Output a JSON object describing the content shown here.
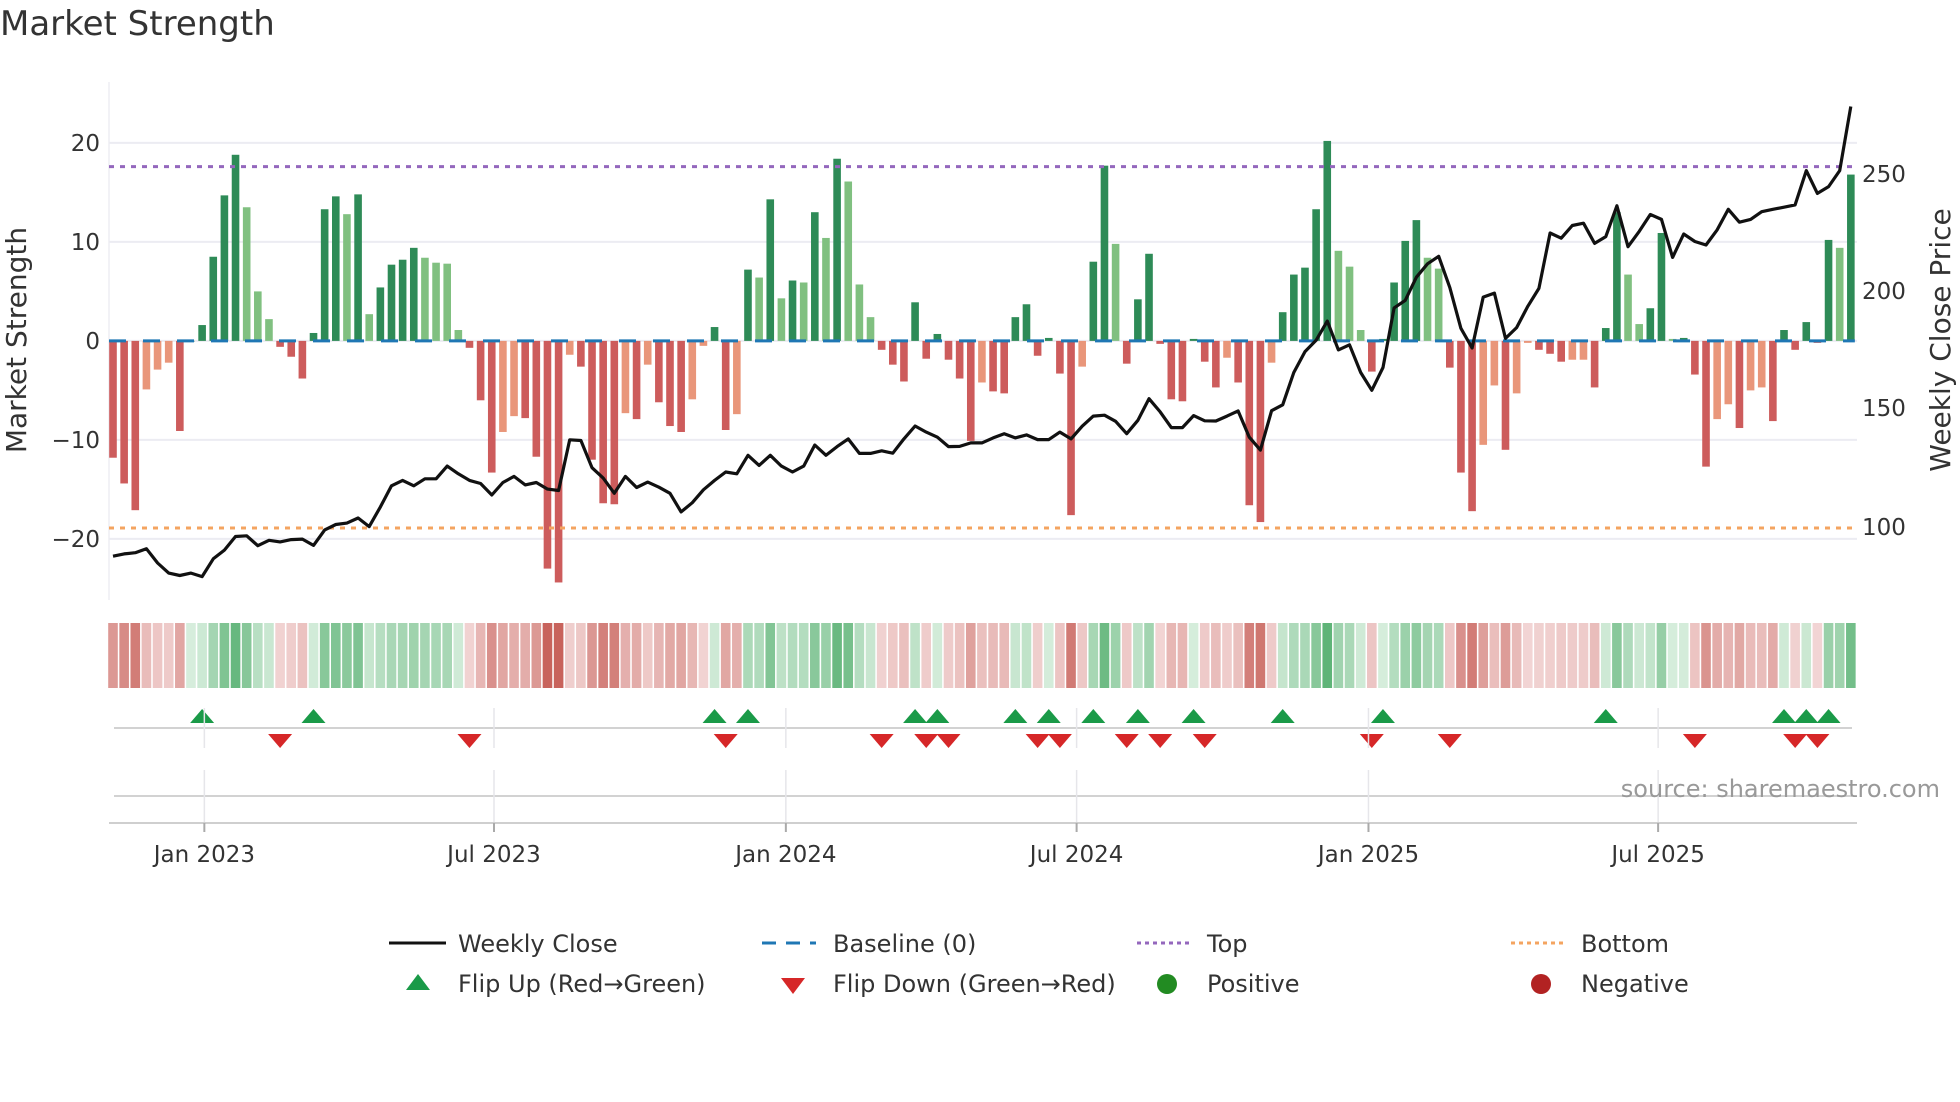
{
  "title": "Market Strength",
  "source": "source: sharemaestro.com",
  "colors": {
    "bar_strong_positive": "#2e8b57",
    "bar_weak_positive": "#80c080",
    "bar_strong_negative": "#cd5c5c",
    "bar_weak_negative": "#e9967a",
    "close_line": "#111111",
    "baseline": "#1f77b4",
    "top": "#9467bd",
    "bottom": "#f4a460",
    "flip_up": "#1a9a48",
    "flip_down": "#d62728",
    "positive": "#228b22",
    "negative": "#b22222"
  },
  "chart_data": {
    "type": "bar+line",
    "title": "Market Strength",
    "ylabel": "Market Strength",
    "y2label": "Weekly Close Price",
    "ylim": [
      -25.5,
      26.5
    ],
    "y2lim": [
      70,
      285
    ],
    "y_ticks": [
      "20",
      "10",
      "0",
      "−10",
      "−20"
    ],
    "y_tick_values": [
      20,
      10,
      0,
      -10,
      -20
    ],
    "y2_ticks": [
      "250",
      "200",
      "150",
      "100"
    ],
    "y2_tick_values": [
      250,
      200,
      150,
      100
    ],
    "x_ticks": [
      {
        "label": "Jan 2023",
        "week_index": 8.2
      },
      {
        "label": "Jul 2023",
        "week_index": 34.2
      },
      {
        "label": "Jan 2024",
        "week_index": 60.4
      },
      {
        "label": "Jul 2024",
        "week_index": 86.5
      },
      {
        "label": "Jan 2025",
        "week_index": 112.7
      },
      {
        "label": "Jul 2025",
        "week_index": 138.7
      }
    ],
    "top_threshold": 17.6,
    "bottom_threshold": -18.9,
    "baseline": 0,
    "strength": [
      -11.8,
      -14.4,
      -17.1,
      -4.9,
      -2.9,
      -2.2,
      -9.1,
      0,
      1.6,
      8.5,
      14.7,
      18.8,
      13.5,
      5.0,
      2.2,
      -0.6,
      -1.6,
      -3.8,
      0.8,
      13.3,
      14.6,
      12.8,
      14.8,
      2.7,
      5.4,
      7.7,
      8.2,
      9.4,
      8.4,
      7.9,
      7.8,
      1.1,
      -0.7,
      -6.0,
      -13.3,
      -9.2,
      -7.6,
      -7.8,
      -11.7,
      -23.0,
      -24.4,
      -1.4,
      -2.6,
      -12.0,
      -16.4,
      -16.5,
      -7.3,
      -7.9,
      -2.4,
      -6.2,
      -8.6,
      -9.2,
      -5.9,
      -0.5,
      1.4,
      -9.0,
      -7.4,
      7.2,
      6.4,
      14.3,
      4.3,
      6.1,
      5.9,
      13.0,
      10.4,
      18.4,
      16.1,
      5.7,
      2.4,
      -0.9,
      -2.4,
      -4.1,
      3.9,
      -1.8,
      0.7,
      -1.9,
      -3.8,
      -10.1,
      -4.2,
      -5.1,
      -5.3,
      2.4,
      3.7,
      -1.5,
      0.3,
      -3.3,
      -17.6,
      -2.6,
      8.0,
      17.7,
      9.8,
      -2.3,
      4.2,
      8.8,
      -0.3,
      -5.9,
      -6.1,
      0.2,
      -2.1,
      -4.7,
      -1.7,
      -4.2,
      -16.6,
      -18.3,
      -2.2,
      2.9,
      6.7,
      7.4,
      13.3,
      20.2,
      9.1,
      7.5,
      1.1,
      -3.1,
      0.2,
      5.9,
      10.1,
      12.2,
      8.4,
      7.3,
      -2.7,
      -13.3,
      -17.2,
      -10.5,
      -4.5,
      -11.0,
      -5.3,
      -0.2,
      -0.9,
      -1.3,
      -2.1,
      -1.9,
      -1.9,
      -4.7,
      1.3,
      13.0,
      6.7,
      1.7,
      3.3,
      10.9,
      0.2,
      0.3,
      -3.4,
      -12.7,
      -7.9,
      -6.4,
      -8.8,
      -5.0,
      -4.7,
      -8.1,
      1.1,
      -0.9,
      1.9,
      -0.2,
      10.2,
      9.4,
      16.8
    ],
    "close": [
      87.4,
      88.4,
      88.9,
      90.6,
      84.5,
      80.2,
      79.2,
      80.2,
      78.7,
      86.3,
      90,
      95.8,
      96.1,
      91.9,
      94.2,
      93.5,
      94.5,
      94.7,
      92,
      98.6,
      100.9,
      101.5,
      103.7,
      100,
      108.4,
      117.4,
      119.7,
      117.4,
      120.4,
      120.4,
      125.8,
      122.5,
      119.7,
      118.4,
      113.5,
      118.8,
      121.4,
      117.8,
      118.8,
      116,
      115.4,
      137,
      136.7,
      125.1,
      120.7,
      114.2,
      121.4,
      116.7,
      119,
      116.8,
      114.2,
      106.3,
      110.2,
      115.7,
      119.7,
      123.3,
      122.5,
      130.4,
      126.1,
      130.4,
      125.8,
      123.3,
      125.8,
      134.8,
      130.4,
      134.1,
      137.4,
      131.2,
      131.2,
      132.3,
      131.3,
      137.4,
      142.9,
      140.3,
      138.1,
      134.1,
      134.2,
      135.7,
      135.7,
      137.8,
      139.6,
      137.8,
      139.1,
      137.1,
      137.1,
      140.3,
      137.4,
      142.8,
      147.1,
      147.5,
      144.9,
      139.6,
      145.3,
      154.5,
      148.9,
      142.2,
      142.2,
      147.3,
      145.1,
      145,
      147.1,
      149.3,
      138.1,
      132.6,
      149.4,
      151.9,
      165.7,
      174.6,
      179.4,
      187.6,
      175.3,
      177.5,
      165.7,
      158.1,
      167.8,
      193.2,
      196.4,
      206.3,
      212,
      215.2,
      201.9,
      184.5,
      176.1,
      197.8,
      199.5,
      180.2,
      184.8,
      193.9,
      201.5,
      225.1,
      222.9,
      228.3,
      229.3,
      220.7,
      223.6,
      236.7,
      219.3,
      225.8,
      233,
      230.9,
      214.7,
      224.7,
      221.5,
      220,
      226.5,
      235.2,
      229.7,
      230.9,
      234.2,
      235.2,
      236.1,
      237.1,
      251.7,
      242,
      244.9,
      251.7,
      279
    ],
    "flip_up": [
      8,
      18,
      54,
      57,
      72,
      74,
      81,
      84,
      88,
      92,
      97,
      105,
      114,
      134,
      150,
      152,
      154
    ],
    "flip_down": [
      15,
      32,
      55,
      69,
      73,
      75,
      83,
      85,
      91,
      94,
      98,
      113,
      120,
      142,
      151,
      153
    ],
    "legend_position": "bottom",
    "legend": [
      {
        "label": "Weekly Close",
        "symbol": "solid-line"
      },
      {
        "label": "Baseline (0)",
        "symbol": "dashed-line"
      },
      {
        "label": "Top",
        "symbol": "dotted-line"
      },
      {
        "label": "Bottom",
        "symbol": "dotted-line"
      },
      {
        "label": "Flip Up (Red→Green)",
        "symbol": "triangle-up"
      },
      {
        "label": "Flip Down (Green→Red)",
        "symbol": "triangle-down"
      },
      {
        "label": "Positive",
        "symbol": "circle"
      },
      {
        "label": "Negative",
        "symbol": "circle"
      }
    ]
  }
}
